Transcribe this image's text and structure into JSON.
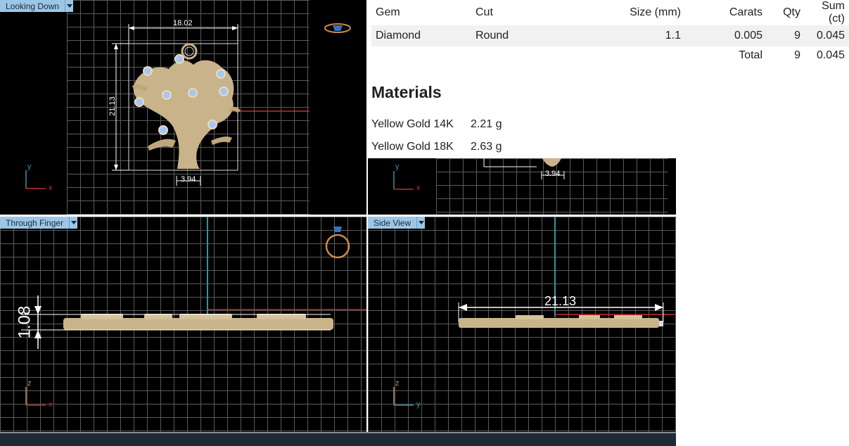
{
  "viewports": {
    "top": {
      "label": "Looking Down",
      "width_dim": "18.02",
      "height_dim": "21.13",
      "bail_dim": "3.94",
      "axis_v": "y",
      "axis_h": "x"
    },
    "front": {
      "label": "Through Finger",
      "thickness_dim": "1.08",
      "axis_v": "z",
      "axis_h": "x"
    },
    "side": {
      "label": "Side View",
      "length_dim": "21.13",
      "axis_v": "z",
      "axis_h": "y"
    },
    "partial": {
      "bail_dim": "3.94",
      "axis_v": "y",
      "axis_h": "x"
    }
  },
  "gems_table": {
    "headers": [
      "Gem",
      "Cut",
      "Size (mm)",
      "Carats",
      "Qty",
      "Sum (ct)"
    ],
    "rows": [
      {
        "gem": "Diamond",
        "cut": "Round",
        "size": "1.1",
        "carats": "0.005",
        "qty": "9",
        "sum": "0.045"
      }
    ],
    "total": {
      "label": "Total",
      "qty": "9",
      "sum": "0.045"
    }
  },
  "materials": {
    "title": "Materials",
    "items": [
      {
        "name": "Yellow Gold 14K",
        "weight": "2.21 g"
      },
      {
        "name": "Yellow Gold 18K",
        "weight": "2.63 g"
      }
    ]
  },
  "colors": {
    "label_bg": "#9cc6e6",
    "gold": "#c9b38a",
    "axis_red": "#c03030",
    "axis_teal": "#3b8fa6",
    "gem_blue": "#a8c6ee"
  }
}
